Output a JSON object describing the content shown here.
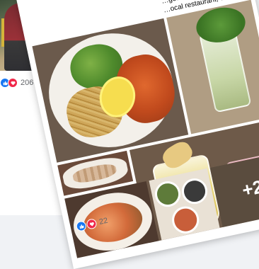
{
  "left_post": {
    "reaction_count": "206",
    "reactions": [
      "like-icon",
      "love-icon"
    ]
  },
  "main_post": {
    "text_line_1": "…get together",
    "text_line_2": "…ocal restaurant, café,",
    "more_photos": "+2",
    "reaction_count": "22",
    "reactions": [
      "like-icon",
      "love-icon"
    ]
  },
  "colors": {
    "like": "#1877f2",
    "love": "#f02849",
    "page_bg": "#f0f2f5"
  }
}
